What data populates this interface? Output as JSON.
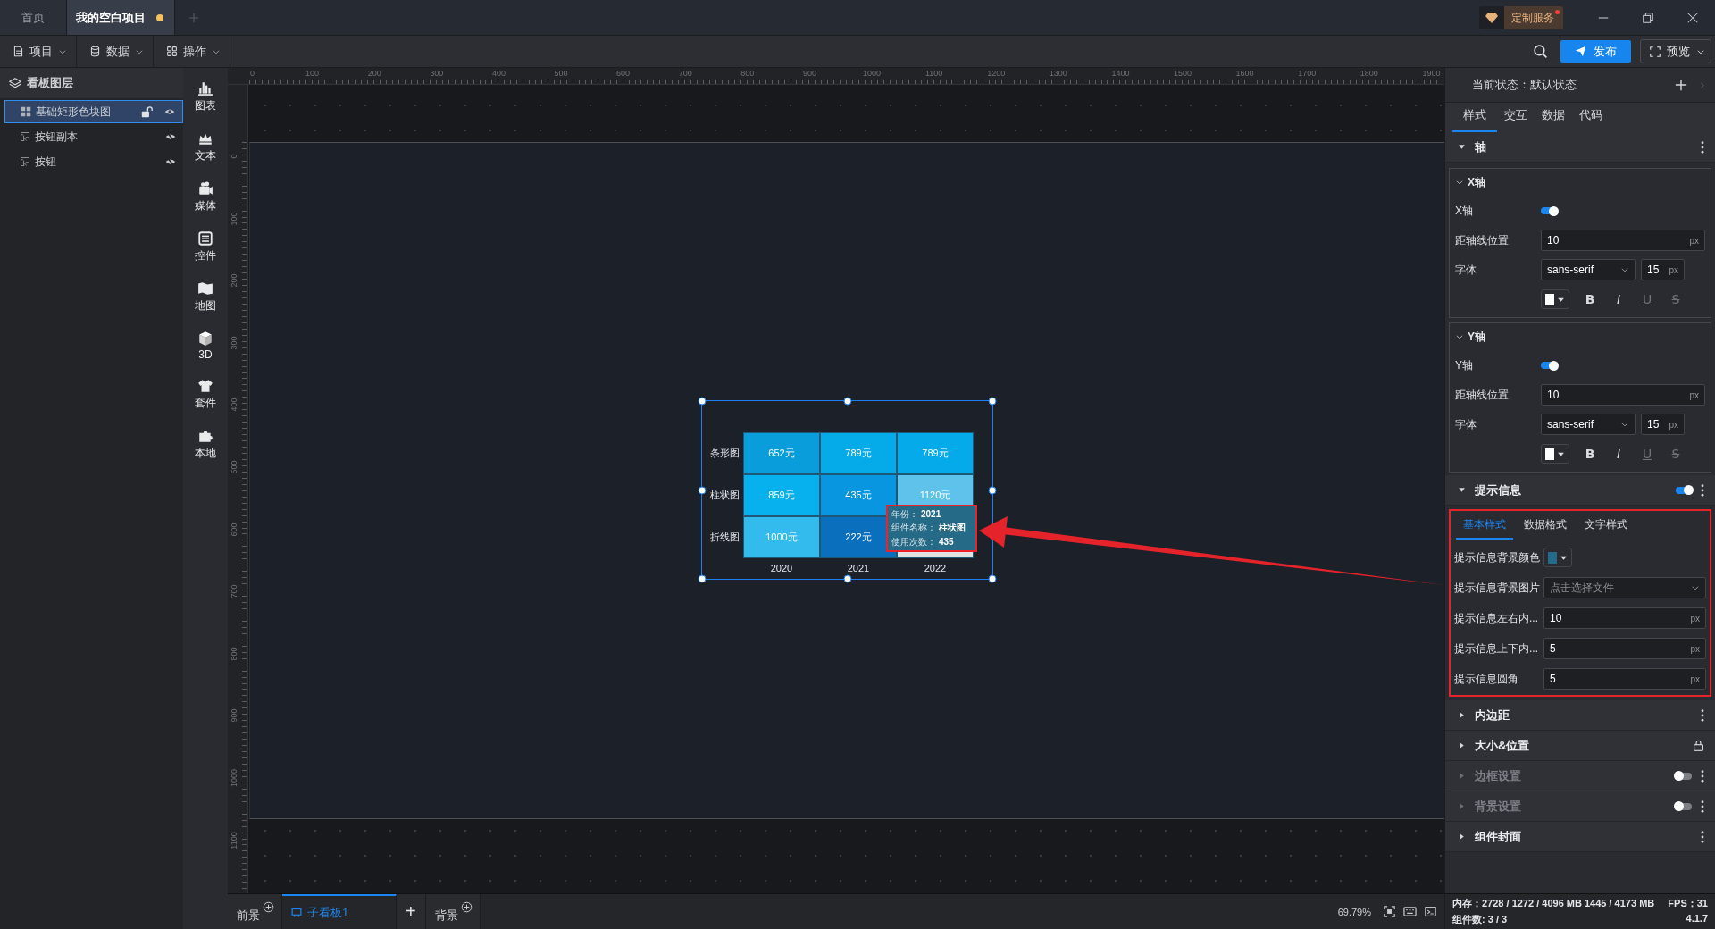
{
  "title_bar": {
    "tabs": [
      {
        "label": "首页",
        "selected": false,
        "unsaved": false
      },
      {
        "label": "我的空白项目",
        "selected": true,
        "unsaved": true
      }
    ],
    "service_badge": {
      "label": "定制服务",
      "notification": true
    }
  },
  "toolbar": {
    "menus": [
      {
        "label": "项目",
        "kind": "file"
      },
      {
        "label": "数据",
        "kind": "database"
      },
      {
        "label": "操作",
        "kind": "grid"
      }
    ],
    "publish": "发布",
    "preview": "预览"
  },
  "layers": {
    "title": "看板图层",
    "items": [
      {
        "name": "基础矩形色块图",
        "kind": "chart",
        "selected": true,
        "visible": true
      },
      {
        "name": "按钮副本",
        "kind": "button",
        "selected": false,
        "visible": false
      },
      {
        "name": "按钮",
        "kind": "button",
        "selected": false,
        "visible": false
      }
    ]
  },
  "components": [
    {
      "label": "图表",
      "kind": "chart"
    },
    {
      "label": "文本",
      "kind": "text"
    },
    {
      "label": "媒体",
      "kind": "media"
    },
    {
      "label": "控件",
      "kind": "control"
    },
    {
      "label": "地图",
      "kind": "map"
    },
    {
      "label": "3D",
      "kind": "cube"
    },
    {
      "label": "套件",
      "kind": "kit"
    },
    {
      "label": "本地",
      "kind": "local"
    }
  ],
  "rulers": {
    "horizontal": [
      "0",
      "100",
      "200",
      "300",
      "400",
      "500",
      "600",
      "700",
      "800",
      "900",
      "1000",
      "1100",
      "1200",
      "1300",
      "1400",
      "1500",
      "1600",
      "1700",
      "1800",
      "1900"
    ],
    "vertical": [
      "0",
      "100",
      "200",
      "300",
      "400",
      "500",
      "600",
      "700",
      "800",
      "900",
      "1000",
      "1100"
    ]
  },
  "heatmap": {
    "rows": [
      "条形图",
      "柱状图",
      "折线图"
    ],
    "columns": [
      "2020",
      "2021",
      "2022"
    ],
    "cells": [
      [
        {
          "value": "652元",
          "color": "#0a9ddb"
        },
        {
          "value": "789元",
          "color": "#05aae8"
        },
        {
          "value": "789元",
          "color": "#04aae9"
        }
      ],
      [
        {
          "value": "859元",
          "color": "#06b1ee"
        },
        {
          "value": "435元",
          "color": "#0896e1"
        },
        {
          "value": "1120元",
          "color": "#5ec2ea"
        }
      ],
      [
        {
          "value": "1000元",
          "color": "#33bbee"
        },
        {
          "value": "222元",
          "color": "#0a6fbc"
        },
        {
          "color": "#e2e2e2"
        }
      ]
    ]
  },
  "tooltip": {
    "lines": [
      {
        "label": "年份：",
        "value": "2021"
      },
      {
        "label": "组件名称：",
        "value": "柱状图"
      },
      {
        "label": "使用次数：",
        "value": "435"
      }
    ]
  },
  "canvas_tabs": [
    {
      "label": "前景",
      "kind": "layer",
      "selected": false
    },
    {
      "label": "子看板1",
      "kind": "board",
      "selected": true
    },
    {
      "label": "+",
      "kind": "add",
      "selected": false
    },
    {
      "label": "背景",
      "kind": "layer",
      "selected": false
    }
  ],
  "zoom": "69.79%",
  "panel": {
    "state": "当前状态：默认状态",
    "tabs": [
      {
        "label": "样式",
        "selected": true
      },
      {
        "label": "交互",
        "selected": false
      },
      {
        "label": "数据",
        "selected": false
      },
      {
        "label": "代码",
        "selected": false
      }
    ],
    "sections": [
      {
        "title": "轴",
        "expanded": true,
        "disabled": false,
        "menu": true,
        "groups": [
          {
            "title": "X轴",
            "rows": [
              {
                "kind": "toggle",
                "label": "X轴",
                "on": true
              },
              {
                "kind": "number",
                "label": "距轴线位置",
                "value": "10",
                "unit": "px"
              },
              {
                "kind": "font",
                "label": "字体",
                "font": "sans-serif",
                "size": "15",
                "unit": "px"
              },
              {
                "kind": "style",
                "color": "#ffffff",
                "buttons": [
                  {
                    "kind": "bold",
                    "glyph": "B",
                    "disabled": false
                  },
                  {
                    "kind": "italic",
                    "glyph": "I",
                    "disabled": false
                  },
                  {
                    "kind": "underline",
                    "glyph": "U",
                    "disabled": true
                  },
                  {
                    "kind": "strike",
                    "glyph": "S",
                    "disabled": true
                  }
                ]
              }
            ]
          },
          {
            "title": "Y轴",
            "rows": [
              {
                "kind": "toggle",
                "label": "Y轴",
                "on": true
              },
              {
                "kind": "number",
                "label": "距轴线位置",
                "value": "10",
                "unit": "px"
              },
              {
                "kind": "font",
                "label": "字体",
                "font": "sans-serif",
                "size": "15",
                "unit": "px"
              },
              {
                "kind": "style",
                "color": "#ffffff",
                "buttons": [
                  {
                    "kind": "bold",
                    "glyph": "B",
                    "disabled": false
                  },
                  {
                    "kind": "italic",
                    "glyph": "I",
                    "disabled": false
                  },
                  {
                    "kind": "underline",
                    "glyph": "U",
                    "disabled": true
                  },
                  {
                    "kind": "strike",
                    "glyph": "S",
                    "disabled": true
                  }
                ]
              }
            ]
          }
        ]
      },
      {
        "title": "提示信息",
        "expanded": true,
        "disabled": false,
        "highlighted": true,
        "toggle_on": true,
        "menu": true,
        "subtabs": [
          {
            "label": "基本样式",
            "selected": true
          },
          {
            "label": "数据格式",
            "selected": false
          },
          {
            "label": "文字样式",
            "selected": false
          }
        ],
        "rows": [
          {
            "kind": "color",
            "label": "提示信息背景颜色",
            "color": "#256a8a"
          },
          {
            "kind": "file",
            "label": "提示信息背景图片",
            "placeholder": "点击选择文件"
          },
          {
            "kind": "number",
            "label": "提示信息左右内...",
            "value": "10",
            "unit": "px"
          },
          {
            "kind": "number",
            "label": "提示信息上下内...",
            "value": "5",
            "unit": "px"
          },
          {
            "kind": "number",
            "label": "提示信息圆角",
            "value": "5",
            "unit": "px"
          }
        ]
      },
      {
        "title": "内边距",
        "expanded": false,
        "disabled": false,
        "menu": true
      },
      {
        "title": "大小&位置",
        "expanded": false,
        "disabled": false,
        "locked": true
      },
      {
        "title": "边框设置",
        "expanded": false,
        "disabled": true,
        "toggle_on": false,
        "menu": true
      },
      {
        "title": "背景设置",
        "expanded": false,
        "disabled": true,
        "toggle_on": false,
        "menu": true
      },
      {
        "title": "组件封面",
        "expanded": false,
        "disabled": false,
        "menu": true
      }
    ]
  },
  "status": {
    "memory": "内存：2728 / 1272 / 4096 MB  1445 / 4173 MB",
    "fps": "FPS：31",
    "count": "组件数: 3 / 3",
    "version": "4.1.7"
  }
}
